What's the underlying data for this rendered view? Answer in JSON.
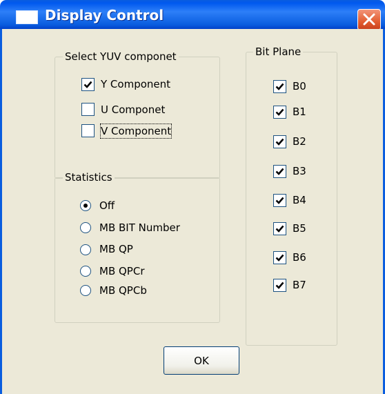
{
  "window": {
    "title": "Display Control",
    "close_icon": "close-icon"
  },
  "yuv_group": {
    "legend": "Select YUV componet",
    "options": [
      {
        "label": "Y Component",
        "checked": true
      },
      {
        "label": "U Componet",
        "checked": false
      },
      {
        "label": "V Component",
        "checked": false
      }
    ]
  },
  "statistics_group": {
    "legend": "Statistics",
    "options": [
      {
        "label": "Off",
        "selected": true
      },
      {
        "label": "MB BIT Number",
        "selected": false
      },
      {
        "label": "MB QP",
        "selected": false
      },
      {
        "label": "MB QPCr",
        "selected": false
      },
      {
        "label": "MB QPCb",
        "selected": false
      }
    ]
  },
  "bitplane_group": {
    "legend": "Bit Plane",
    "options": [
      {
        "label": "B0",
        "checked": true
      },
      {
        "label": "B1",
        "checked": true
      },
      {
        "label": "B2",
        "checked": true
      },
      {
        "label": "B3",
        "checked": true
      },
      {
        "label": "B4",
        "checked": true
      },
      {
        "label": "B5",
        "checked": true
      },
      {
        "label": "B6",
        "checked": true
      },
      {
        "label": "B7",
        "checked": true
      }
    ]
  },
  "ok_button": {
    "label": "OK"
  },
  "colors": {
    "titlebar": "#0a5ddf",
    "client_bg": "#ece9d8",
    "close_button": "#e25d31"
  }
}
